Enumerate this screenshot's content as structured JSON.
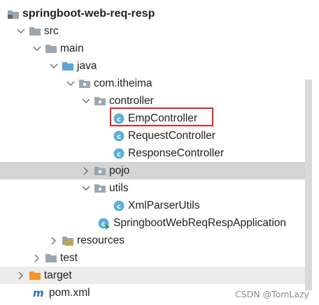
{
  "project": {
    "name": "springboot-web-req-resp"
  },
  "tree": {
    "src": "src",
    "main": "main",
    "java": "java",
    "package": "com.itheima",
    "controller": "controller",
    "emp_controller": "EmpController",
    "request_controller": "RequestController",
    "response_controller": "ResponseController",
    "pojo": "pojo",
    "utils": "utils",
    "xml_parser_utils": "XmlParserUtils",
    "application": "SpringbootWebReqRespApplication",
    "resources": "resources",
    "test": "test",
    "target": "target",
    "pom": "pom.xml"
  },
  "watermark": "CSDN @TomLazy",
  "colors": {
    "highlight_border": "#e02323",
    "selected_row": "#d4d4d4",
    "excluded_row": "#ececec",
    "class_icon": "#5ab0d8",
    "target_folder": "#f0952b",
    "maven_icon": "#2b6fb7"
  },
  "icons": {
    "folder": "folder-icon",
    "source_folder": "source-folder-icon",
    "package": "package-icon",
    "class": "class-icon",
    "application": "spring-boot-class-icon",
    "resources": "resources-folder-icon",
    "target": "excluded-folder-icon",
    "maven": "maven-icon",
    "expanded": "chevron-down-icon",
    "collapsed": "chevron-right-icon"
  }
}
